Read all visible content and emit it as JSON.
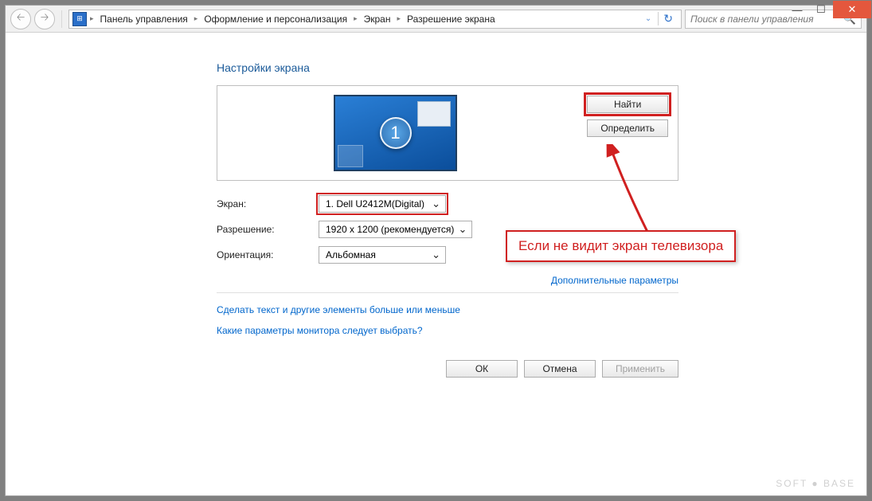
{
  "titlebar": {},
  "breadcrumb": {
    "items": [
      "Панель управления",
      "Оформление и персонализация",
      "Экран",
      "Разрешение экрана"
    ]
  },
  "search": {
    "placeholder": "Поиск в панели управления"
  },
  "page": {
    "title": "Настройки экрана"
  },
  "preview": {
    "monitor_number": "1",
    "find_button": "Найти",
    "detect_button": "Определить"
  },
  "form": {
    "display_label": "Экран:",
    "display_value": "1. Dell U2412M(Digital)",
    "resolution_label": "Разрешение:",
    "resolution_value": "1920 x 1200 (рекомендуется)",
    "orientation_label": "Ориентация:",
    "orientation_value": "Альбомная"
  },
  "links": {
    "advanced": "Дополнительные параметры",
    "bigger_text": "Сделать текст и другие элементы больше или меньше",
    "which_settings": "Какие параметры монитора следует выбрать?"
  },
  "buttons": {
    "ok": "ОК",
    "cancel": "Отмена",
    "apply": "Применить"
  },
  "callout": {
    "text": "Если не видит экран телевизора"
  },
  "watermark": "SOFT ● BASE"
}
